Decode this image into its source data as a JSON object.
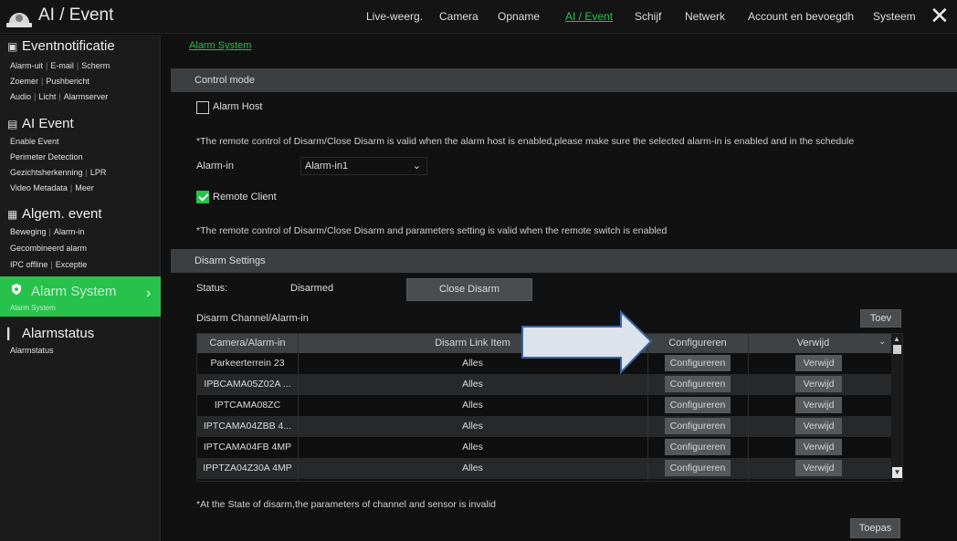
{
  "app": {
    "title": "AI / Event",
    "close_glyph": "✕"
  },
  "nav": [
    {
      "label": "Live-weerg.",
      "active": false
    },
    {
      "label": "Camera",
      "active": false
    },
    {
      "label": "Opname",
      "active": false
    },
    {
      "label": "AI / Event",
      "active": true
    },
    {
      "label": "Schijf",
      "active": false
    },
    {
      "label": "Netwerk",
      "active": false
    },
    {
      "label": "Account en bevoegdh",
      "active": false
    },
    {
      "label": "Systeem",
      "active": false
    }
  ],
  "sidebar": {
    "eventnotificatie": {
      "title": "Eventnotificatie",
      "line1": [
        "Alarm-uit",
        "E-mail",
        "Scherm"
      ],
      "line2": [
        "Zoemer",
        "Pushbericht"
      ],
      "line3": [
        "Audio",
        "Licht",
        "Alarmserver"
      ]
    },
    "ai_event": {
      "title": "AI Event",
      "line1": [
        "Enable Event"
      ],
      "line2": [
        "Perimeter Detection"
      ],
      "line3": [
        "Gezichtsherkenning",
        "LPR"
      ],
      "line4": [
        "Video Metadata",
        "Meer"
      ]
    },
    "algem_event": {
      "title": "Algem. event",
      "line1": [
        "Beweging",
        "Alarm-in"
      ],
      "line2": [
        "Gecombineerd alarm"
      ],
      "line3": [
        "IPC offline",
        "Exceptie"
      ]
    },
    "alarm_system": {
      "title": "Alarm System",
      "sub": "Alarm System"
    },
    "alarmstatus": {
      "title": "Alarmstatus",
      "sub": "Alarmstatus"
    }
  },
  "main": {
    "breadcrumb": "Alarm System",
    "control_mode": {
      "title": "Control mode",
      "alarm_host_label": "Alarm Host",
      "alarm_host_checked": false,
      "note1": "*The remote control of Disarm/Close Disarm is valid when the alarm host is enabled,please make sure the selected alarm-in is enabled and in the schedule",
      "alarm_in_label": "Alarm-in",
      "alarm_in_value": "Alarm-in1",
      "remote_client_label": "Remote Client",
      "remote_client_checked": true,
      "note2": "*The remote control of Disarm/Close Disarm and parameters setting is valid when the remote switch is enabled"
    },
    "disarm_settings": {
      "title": "Disarm Settings",
      "status_label": "Status:",
      "status_value": "Disarmed",
      "close_disarm_button": "Close Disarm",
      "channel_label": "Disarm Channel/Alarm-in",
      "add_button": "Toev",
      "table": {
        "headers": [
          "Camera/Alarm-in",
          "Disarm Link Item",
          "Configureren",
          "Verwijd"
        ],
        "rows": [
          {
            "camera": "Parkeerterrein 23",
            "link": "Alles",
            "config": "Configureren",
            "delete": "Verwijd"
          },
          {
            "camera": "IPBCAMA05Z02A ...",
            "link": "Alles",
            "config": "Configureren",
            "delete": "Verwijd"
          },
          {
            "camera": "IPTCAMA08ZC",
            "link": "Alles",
            "config": "Configureren",
            "delete": "Verwijd"
          },
          {
            "camera": "IPTCAMA04ZBB 4...",
            "link": "Alles",
            "config": "Configureren",
            "delete": "Verwijd"
          },
          {
            "camera": "IPTCAMA04FB 4MP",
            "link": "Alles",
            "config": "Configureren",
            "delete": "Verwijd"
          },
          {
            "camera": "IPPTZA04Z30A 4MP",
            "link": "Alles",
            "config": "Configureren",
            "delete": "Verwijd"
          }
        ]
      },
      "note": "*At the State of disarm,the parameters of channel and sensor is invalid",
      "apply_button": "Toepas"
    }
  },
  "colors": {
    "accent": "#27c24c",
    "section_bar": "#3b3f42",
    "button": "#4a4d50"
  },
  "icons": {
    "logo": "camera-dome-icon",
    "close": "close-icon",
    "scroll_down": "chevron-down-icon",
    "scroll_up": "chevron-up-icon",
    "arrow": "annotation-arrow"
  }
}
